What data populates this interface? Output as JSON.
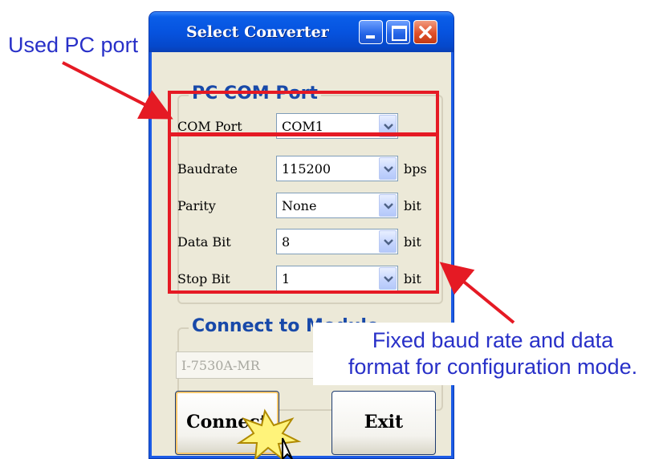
{
  "window": {
    "title": "Select Converter"
  },
  "pc_com_port": {
    "legend": "PC COM Port",
    "rows": [
      {
        "label": "COM Port",
        "value": "COM1",
        "unit": ""
      },
      {
        "label": "Baudrate",
        "value": "115200",
        "unit": "bps"
      },
      {
        "label": "Parity",
        "value": "None",
        "unit": "bit"
      },
      {
        "label": "Data Bit",
        "value": "8",
        "unit": "bit"
      },
      {
        "label": "Stop Bit",
        "value": "1",
        "unit": "bit"
      }
    ]
  },
  "connect_to_module": {
    "legend": "Connect to Module",
    "module_value": "I-7530A-MR"
  },
  "buttons": {
    "connect": "Connect",
    "exit": "Exit"
  },
  "annotations": {
    "used_pc_port": "Used PC port",
    "fixed_line1": "Fixed baud rate and data",
    "fixed_line2": "format for configuration mode."
  },
  "colors": {
    "highlight": "#e51a24",
    "annotation_text": "#2830c8",
    "titlebar": "#0653df",
    "legend_text": "#1849a9"
  }
}
